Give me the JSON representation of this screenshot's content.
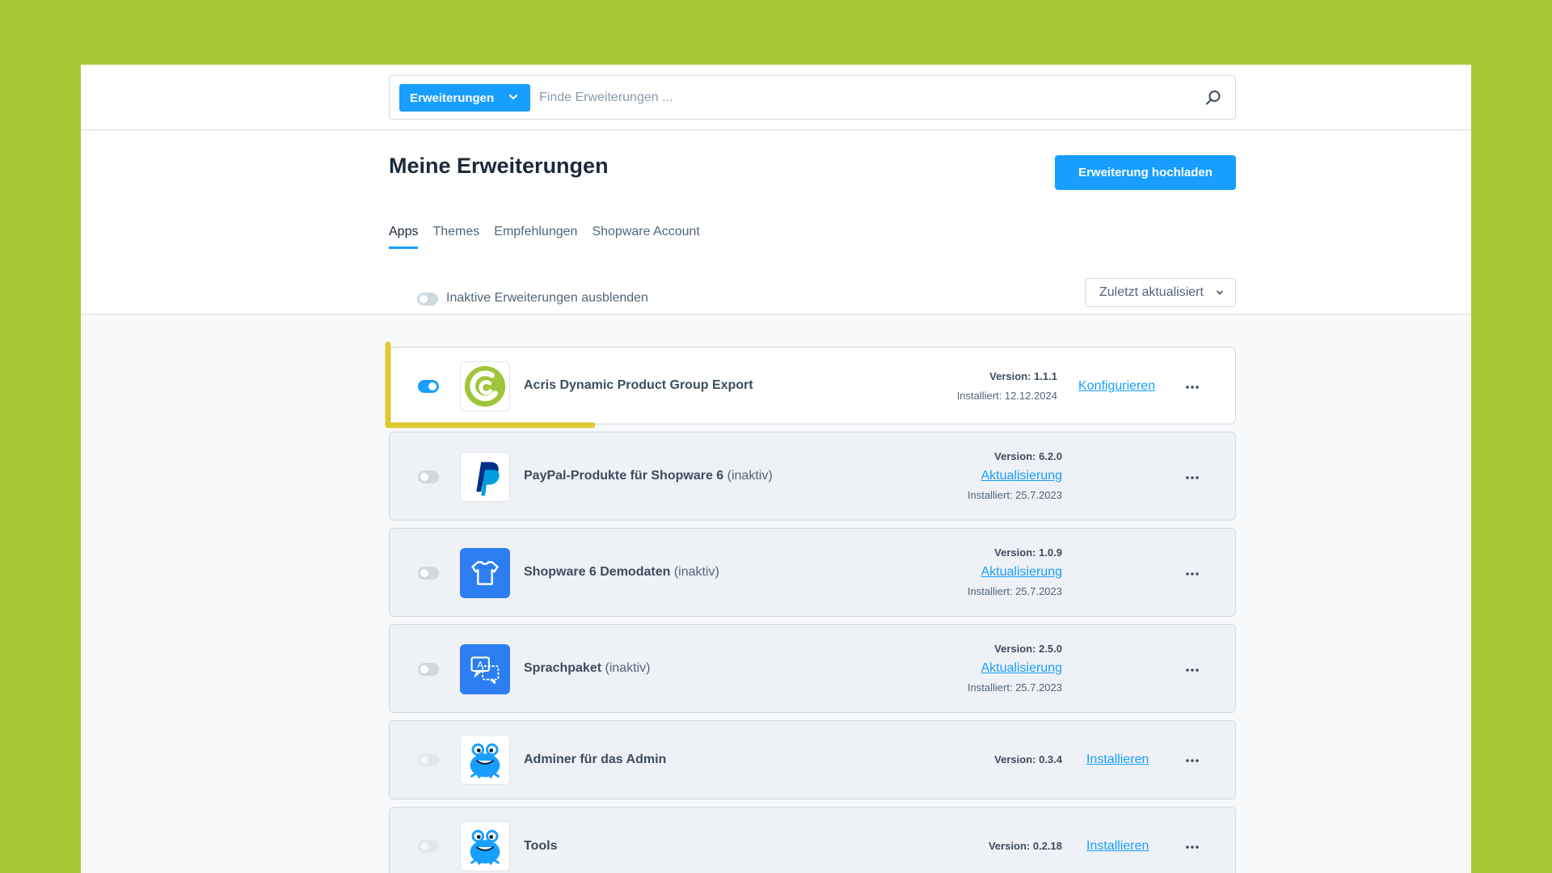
{
  "search": {
    "type_label": "Erweiterungen",
    "placeholder": "Finde Erweiterungen ..."
  },
  "page": {
    "title": "Meine Erweiterungen",
    "upload_label": "Erweiterung hochladen"
  },
  "tabs": [
    {
      "label": "Apps",
      "active": true
    },
    {
      "label": "Themes",
      "active": false
    },
    {
      "label": "Empfehlungen",
      "active": false
    },
    {
      "label": "Shopware Account",
      "active": false
    }
  ],
  "filter": {
    "hide_inactive_label": "Inaktive Erweiterungen ausblenden",
    "sort_label": "Zuletzt aktualisiert"
  },
  "extensions": [
    {
      "name": "Acris Dynamic Product Group Export",
      "status": "",
      "version": "Version: 1.1.1",
      "installed": "Installiert: 12.12.2024",
      "action": "Konfigurieren",
      "icon": "acris-logo-icon"
    },
    {
      "name": "PayPal-Produkte für Shopware 6",
      "status": "(inaktiv)",
      "version": "Version: 6.2.0",
      "update": "Aktualisierung",
      "installed": "Installiert: 25.7.2023",
      "icon": "paypal-logo-icon"
    },
    {
      "name": "Shopware 6 Demodaten",
      "status": "(inaktiv)",
      "version": "Version: 1.0.9",
      "update": "Aktualisierung",
      "installed": "Installiert: 25.7.2023",
      "icon": "tshirt-icon"
    },
    {
      "name": "Sprachpaket",
      "status": "(inaktiv)",
      "version": "Version: 2.5.0",
      "update": "Aktualisierung",
      "installed": "Installiert: 25.7.2023",
      "icon": "translate-icon"
    },
    {
      "name": "Adminer für das Admin",
      "status": "",
      "version": "Version: 0.3.4",
      "action": "Installieren",
      "icon": "frog-mascot-icon"
    },
    {
      "name": "Tools",
      "status": "",
      "version": "Version: 0.2.18",
      "action": "Installieren",
      "icon": "frog-mascot-icon"
    }
  ],
  "colors": {
    "background": "#a8c936",
    "accent": "#189eff",
    "highlight": "#d9c418"
  }
}
